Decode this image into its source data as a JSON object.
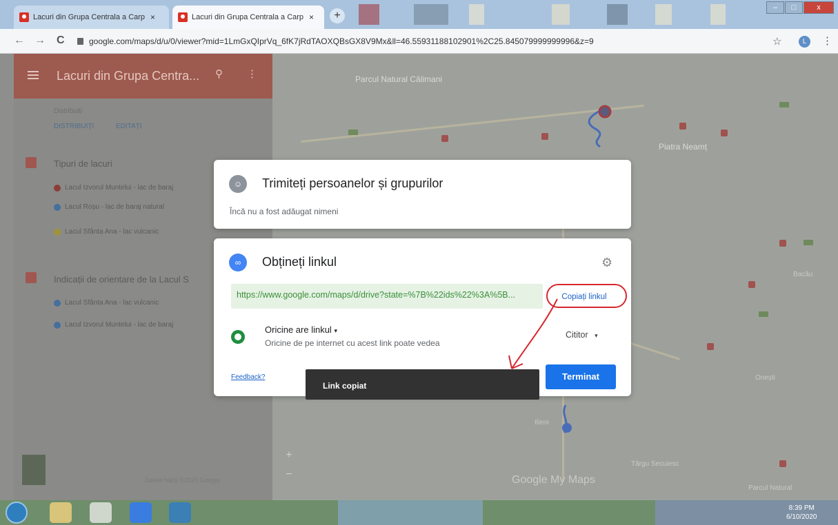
{
  "browser": {
    "tabs": [
      {
        "label": "Lacuri din Grupa Centrala a Carp",
        "close": "×"
      },
      {
        "label": "Lacuri din Grupa Centrala a Carp",
        "close": "×"
      }
    ],
    "new_tab": "+",
    "url": "google.com/maps/d/u/0/viewer?mid=1LmGxQIprVq_6fK7jRdTAOXQBsGX8V9Mx&ll=46.55931188102901%2C25.845079999999996&z=9",
    "nav": {
      "back": "←",
      "forward": "→",
      "reload": "C"
    },
    "star": "☆",
    "profile": "L",
    "menu": "⋮",
    "window_controls": {
      "minimize": "–",
      "maximize": "□",
      "close": "x"
    }
  },
  "panel": {
    "title": "Lacuri din Grupa Centra...",
    "search_icon": "⚲",
    "kebab": "⋮",
    "meta": "Distribuiți",
    "share": "DISTRIBUIȚI",
    "edit": "EDITAȚI",
    "layers": [
      {
        "title": "Tipuri de lacuri",
        "items": [
          "Lacul Izvorul Muntelui - lac de baraj",
          "Lacul Roșu - lac de baraj natural",
          "Lacul Sfânta Ana - lac vulcanic"
        ]
      },
      {
        "title": "Indicații de orientare de la Lacul S",
        "items": [
          "Lacul Sfânta Ana - lac vulcanic",
          "Lacul Izvorul Muntelui - lac de baraj"
        ]
      }
    ],
    "footer": "Datele hărții ©2020 Google"
  },
  "map": {
    "labels": [
      "Parcul Natural Călimani",
      "Piatra Neamț",
      "Târgu Secuiesc",
      "Parcul Natural",
      "Ilieni",
      "Bacău",
      "Onești"
    ],
    "brand": "Google My Maps",
    "zoom_in": "+",
    "zoom_out": "−"
  },
  "share_dialog": {
    "title": "Trimiteți persoanelor și grupurilor",
    "subtitle": "Încă nu a fost adăugat nimeni"
  },
  "link_dialog": {
    "title": "Obțineți linkul",
    "url": "https://www.google.com/maps/d/drive?state=%7B%22ids%22%3A%5B...",
    "copy_label": "Copiați linkul",
    "access_title": "Oricine are linkul",
    "access_sub": "Oricine de pe internet cu acest link poate vedea",
    "role": "Cititor",
    "feedback": "Feedback?",
    "done": "Terminat"
  },
  "toast": {
    "text": "Link copiat"
  },
  "taskbar": {
    "time": "8:39 PM",
    "date": "6/10/2020"
  },
  "colors": {
    "accent": "#1a73e8",
    "annotation": "#d7262e"
  }
}
